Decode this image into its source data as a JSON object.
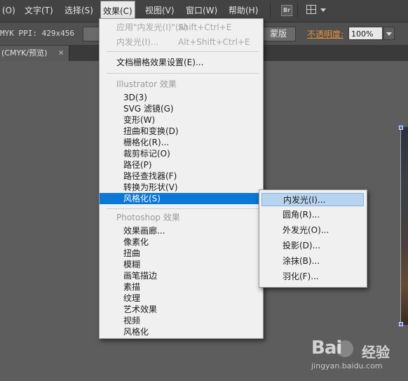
{
  "menubar": {
    "items": [
      "(O)",
      "文字(T)",
      "选择(S)",
      "效果(C)",
      "视图(V)",
      "窗口(W)",
      "帮助(H)"
    ],
    "active_index": 3,
    "bridge_icon_text": "Br"
  },
  "controlbar": {
    "info": "MYK PPI: 429x456",
    "button": "蒙版",
    "opacity_label": "不透明度:",
    "opacity_value": "100%"
  },
  "tab": {
    "label": "(CMYK/预览)",
    "close": "×"
  },
  "effect_menu": {
    "apply_last": {
      "label": "应用\"内发光(I)\"(A)",
      "shortcut": "Shift+Ctrl+E"
    },
    "last_effect": {
      "label": "内发光(I)...",
      "shortcut": "Alt+Shift+Ctrl+E"
    },
    "raster_settings": "文档栅格效果设置(E)...",
    "illustrator_heading": "Illustrator 效果",
    "illustrator_items": [
      "3D(3)",
      "SVG 滤镜(G)",
      "变形(W)",
      "扭曲和变换(D)",
      "栅格化(R)...",
      "裁剪标记(O)",
      "路径(P)",
      "路径查找器(F)",
      "转换为形状(V)",
      "风格化(S)"
    ],
    "highlighted_index": 9,
    "photoshop_heading": "Photoshop 效果",
    "photoshop_items": [
      "效果画廊...",
      "像素化",
      "扭曲",
      "模糊",
      "画笔描边",
      "素描",
      "纹理",
      "艺术效果",
      "视频",
      "风格化"
    ]
  },
  "stylize_submenu": {
    "items": [
      "内发光(I)...",
      "圆角(R)...",
      "外发光(O)...",
      "投影(D)...",
      "涂抹(B)...",
      "羽化(F)..."
    ],
    "hover_index": 0
  },
  "watermark": {
    "logo": "Bai",
    "logo_suffix": "经验",
    "url": "jingyan.baidu.com"
  },
  "colors": {
    "highlight": "#0a78d6",
    "opacity_label": "#e8923a",
    "hover": "#b6d4f0"
  }
}
